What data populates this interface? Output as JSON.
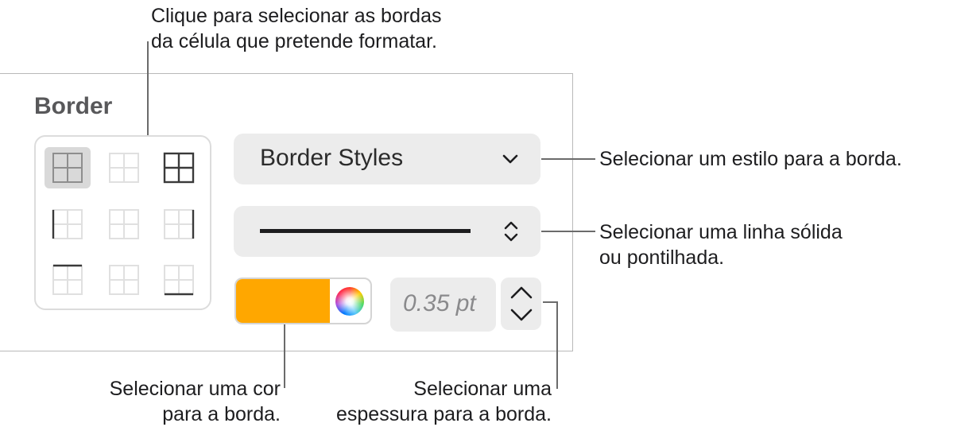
{
  "callouts": {
    "grid": [
      "Clique para selecionar as bordas",
      "da célula que pretende formatar."
    ],
    "style": [
      "Selecionar um estilo para a borda."
    ],
    "line": [
      "Selecionar uma linha sólida",
      "ou pontilhada."
    ],
    "color": [
      "Selecionar uma cor",
      "para a borda."
    ],
    "thickness": [
      "Selecionar uma",
      "espessura para a borda."
    ]
  },
  "panel": {
    "title": "Border",
    "border_styles_label": "Border Styles",
    "thickness_value": "0.35 pt",
    "color": "#ffa700"
  },
  "icons": [
    "chevron-down-icon",
    "up-down-arrows-icon",
    "color-wheel-icon",
    "chevron-up-icon"
  ]
}
